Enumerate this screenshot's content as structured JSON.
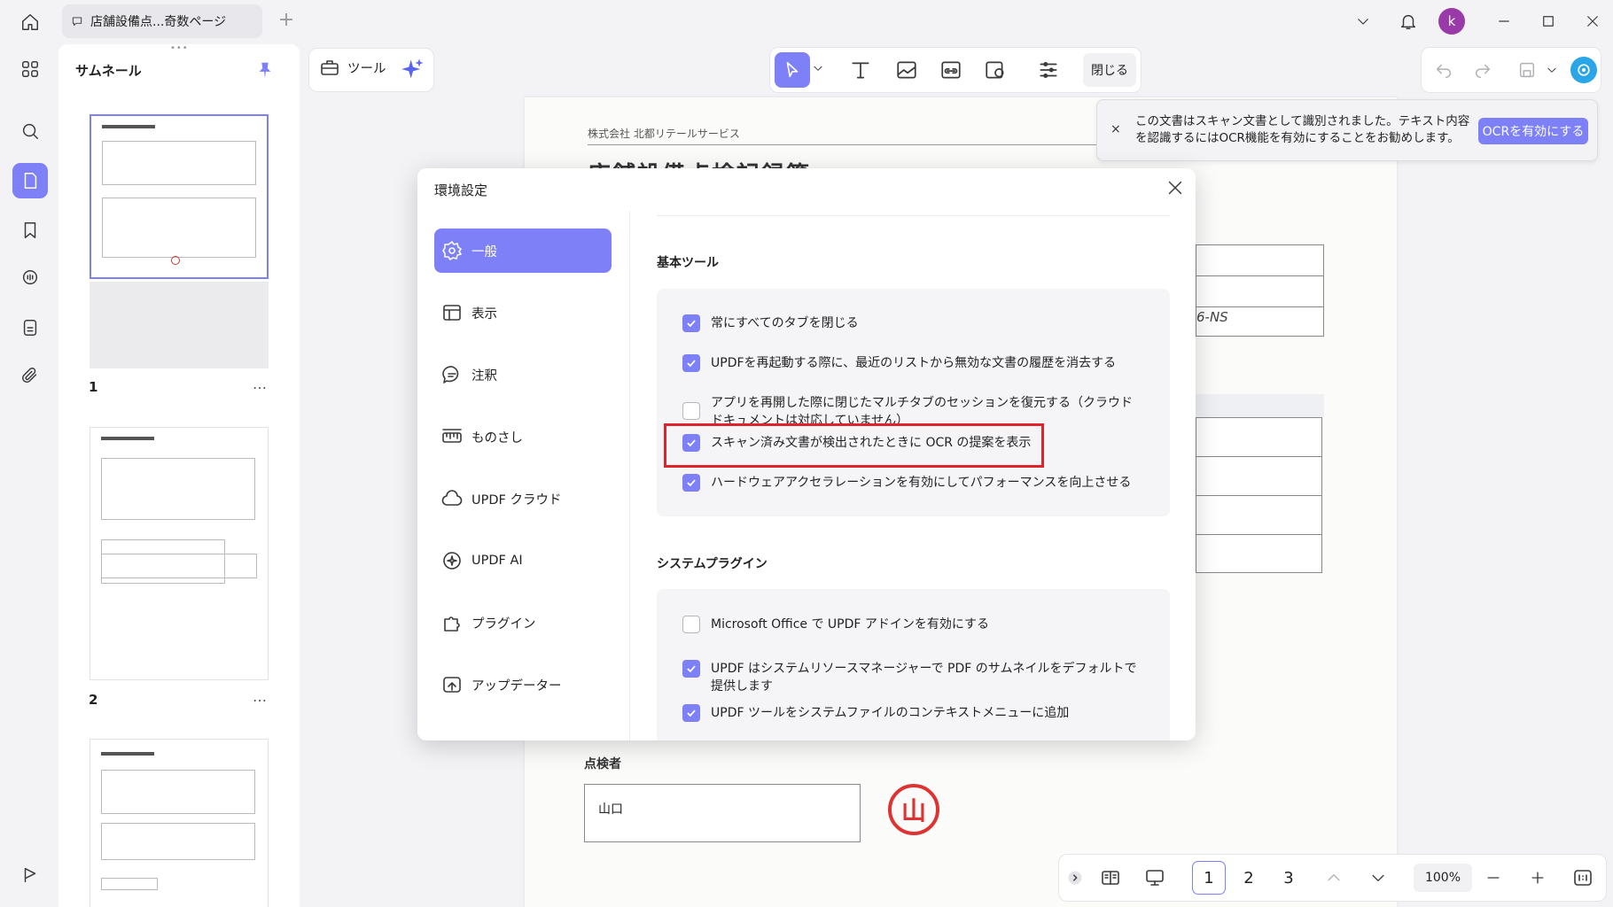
{
  "tab": {
    "title": "店舗設備点...奇数ページ"
  },
  "account": {
    "initial": "k"
  },
  "thumbnails": {
    "title": "サムネール",
    "pages": [
      {
        "num": "1"
      },
      {
        "num": "2"
      }
    ],
    "more": "…"
  },
  "toolbar": {
    "tools_label": "ツール",
    "close_label": "閉じる"
  },
  "ocr_banner": {
    "message": "この文書はスキャン文書として識別されました。テキスト内容を認識するにはOCR機能を有効にすることをお勧めします。",
    "button": "OCRを有効にする",
    "close": "×"
  },
  "document": {
    "company": "株式会社 北都リテールサービス",
    "heading": "店舗設備点検記録簿",
    "handwritten": "6-NS",
    "inspector_label": "点検者",
    "inspector_value": "山口",
    "stamp": "山"
  },
  "settings": {
    "title": "環境設定",
    "nav": [
      {
        "label": "一般",
        "icon": "gear-icon",
        "active": true
      },
      {
        "label": "表示",
        "icon": "layout-icon"
      },
      {
        "label": "注釈",
        "icon": "comment-icon"
      },
      {
        "label": "ものさし",
        "icon": "ruler-icon"
      },
      {
        "label": "UPDF クラウド",
        "icon": "cloud-icon"
      },
      {
        "label": "UPDF AI",
        "icon": "ai-icon"
      },
      {
        "label": "プラグイン",
        "icon": "puzzle-icon"
      },
      {
        "label": "アップデーター",
        "icon": "update-icon"
      }
    ],
    "basic_tools": {
      "title": "基本ツール",
      "options": [
        {
          "label": "常にすべてのタブを閉じる",
          "checked": true
        },
        {
          "label": "UPDFを再起動する際に、最近のリストから無効な文書の履歴を消去する",
          "checked": true
        },
        {
          "label": "アプリを再開した際に閉じたマルチタブのセッションを復元する（クラウドドキュメントは対応していません）",
          "checked": false
        },
        {
          "label": "スキャン済み文書が検出されたときに OCR の提案を表示",
          "checked": true
        },
        {
          "label": "ハードウェアアクセラレーションを有効にしてパフォーマンスを向上させる",
          "checked": true
        }
      ]
    },
    "system_plugins": {
      "title": "システムプラグイン",
      "options": [
        {
          "label": "Microsoft Office で UPDF アドインを有効にする",
          "checked": false
        },
        {
          "label": "UPDF はシステムリソースマネージャーで PDF のサムネイルをデフォルトで提供します",
          "checked": true
        },
        {
          "label": "UPDF ツールをシステムファイルのコンテキストメニューに追加",
          "checked": true
        }
      ]
    }
  },
  "pagination": {
    "pages": [
      "1",
      "2",
      "3"
    ],
    "current": "1",
    "zoom": "100%"
  },
  "colors": {
    "accent": "#7d80f7",
    "highlight": "#e0222b",
    "stamp": "#dd3333"
  }
}
